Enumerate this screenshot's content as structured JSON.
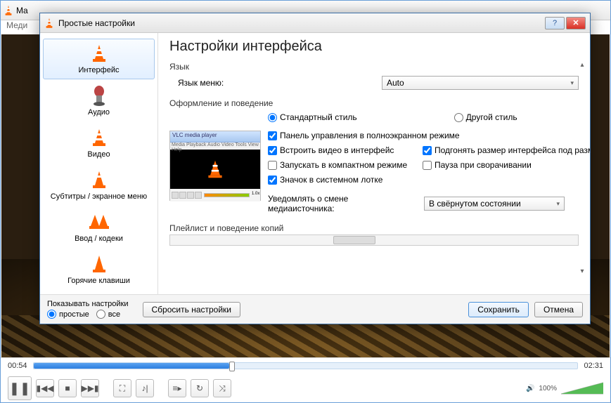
{
  "main": {
    "title": "Ma",
    "menu_visible": "Меди",
    "time_current": "00:54",
    "time_total": "02:31",
    "volume_pct": "100%",
    "seek_pct": 36
  },
  "dialog": {
    "title": "Простые настройки",
    "categories": [
      {
        "label": "Интерфейс"
      },
      {
        "label": "Аудио"
      },
      {
        "label": "Видео"
      },
      {
        "label": "Субтитры / экранное меню"
      },
      {
        "label": "Ввод / кодеки"
      },
      {
        "label": "Горячие клавиши"
      }
    ],
    "heading": "Настройки интерфейса",
    "lang_section": "Язык",
    "lang_label": "Язык меню:",
    "lang_value": "Auto",
    "appearance_section": "Оформление и поведение",
    "style_native": "Стандартный стиль",
    "style_other": "Другой стиль",
    "checks": {
      "fullscreen_panel": "Панель управления в полноэкранном режиме",
      "embed_video": "Встроить видео в интерфейс",
      "resize_interface": "Подгонять размер интерфейса под разме",
      "compact": "Запускать в компактном режиме",
      "pause_minimize": "Пауза при сворачивании",
      "systray": "Значок в системном лотке"
    },
    "notify_label": "Уведомлять о смене медиаисточника:",
    "notify_value": "В свёрнутом состоянии",
    "playlist_section": "Плейлист и поведение копий",
    "footer": {
      "show_label": "Показывать настройки",
      "simple": "простые",
      "all": "все",
      "reset": "Сбросить настройки",
      "save": "Сохранить",
      "cancel": "Отмена"
    }
  }
}
